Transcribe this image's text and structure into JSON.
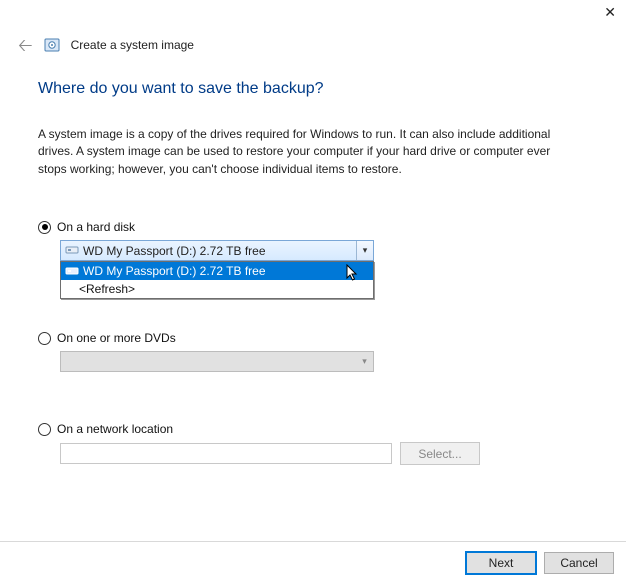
{
  "header": {
    "title": "Create a system image"
  },
  "question": "Where do you want to save the backup?",
  "description": "A system image is a copy of the drives required for Windows to run. It can also include additional drives. A system image can be used to restore your computer if your hard drive or computer ever stops working; however, you can't choose individual items to restore.",
  "options": {
    "hard_disk": {
      "label": "On a hard disk",
      "selected_value": "WD My Passport (D:)  2.72 TB free",
      "dropdown": {
        "item_selected": "WD My Passport (D:)  2.72 TB free",
        "item_refresh": "<Refresh>"
      }
    },
    "dvd": {
      "label": "On one or more DVDs"
    },
    "network": {
      "label": "On a network location",
      "select_button": "Select..."
    }
  },
  "footer": {
    "next": "Next",
    "cancel": "Cancel"
  }
}
